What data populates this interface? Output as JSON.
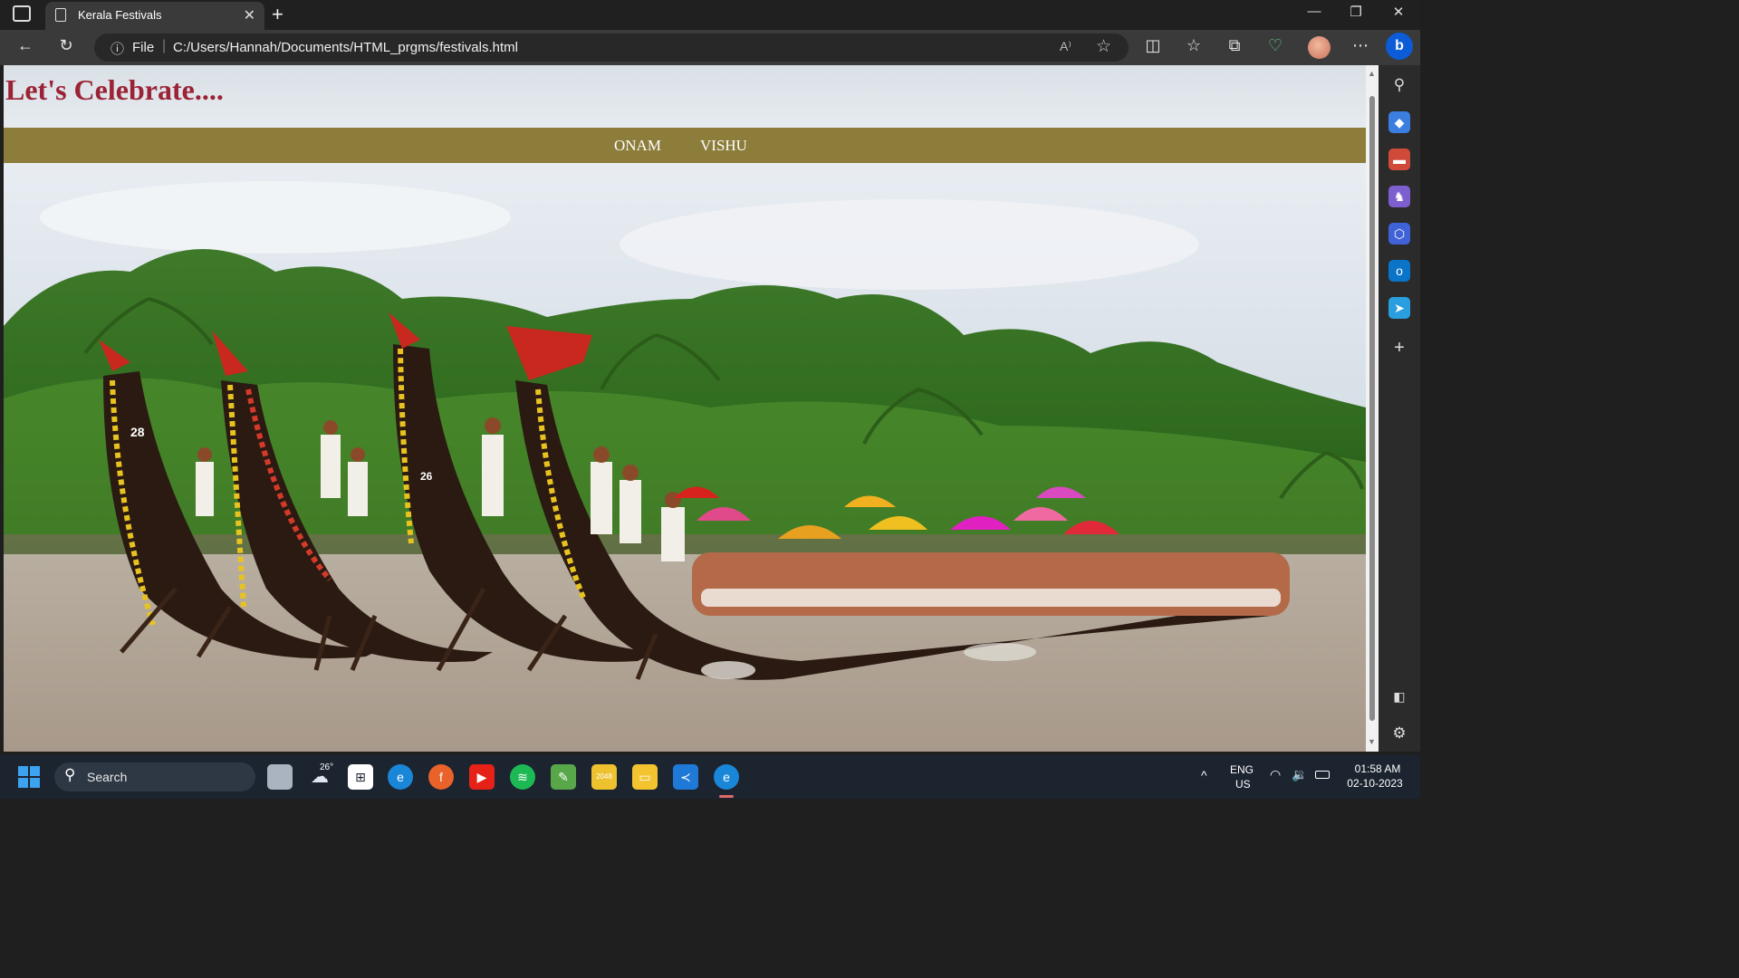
{
  "browser": {
    "tab_title": "Kerala Festivals",
    "address_prefix": "File",
    "url": "C:/Users/Hannah/Documents/HTML_prgms/festivals.html"
  },
  "page": {
    "title": "Let's Celebrate....",
    "menu": [
      {
        "label": "ONAM"
      },
      {
        "label": "VISHU"
      }
    ],
    "hero_boat_numbers": [
      "28",
      "26"
    ]
  },
  "taskbar": {
    "search_placeholder": "Search",
    "weather_temp": "26°",
    "language": "ENG",
    "region": "US",
    "time": "01:58 AM",
    "date": "02-10-2023"
  },
  "colors": {
    "title_color": "#9b2335",
    "menu_bg": "#8c7d3a"
  }
}
